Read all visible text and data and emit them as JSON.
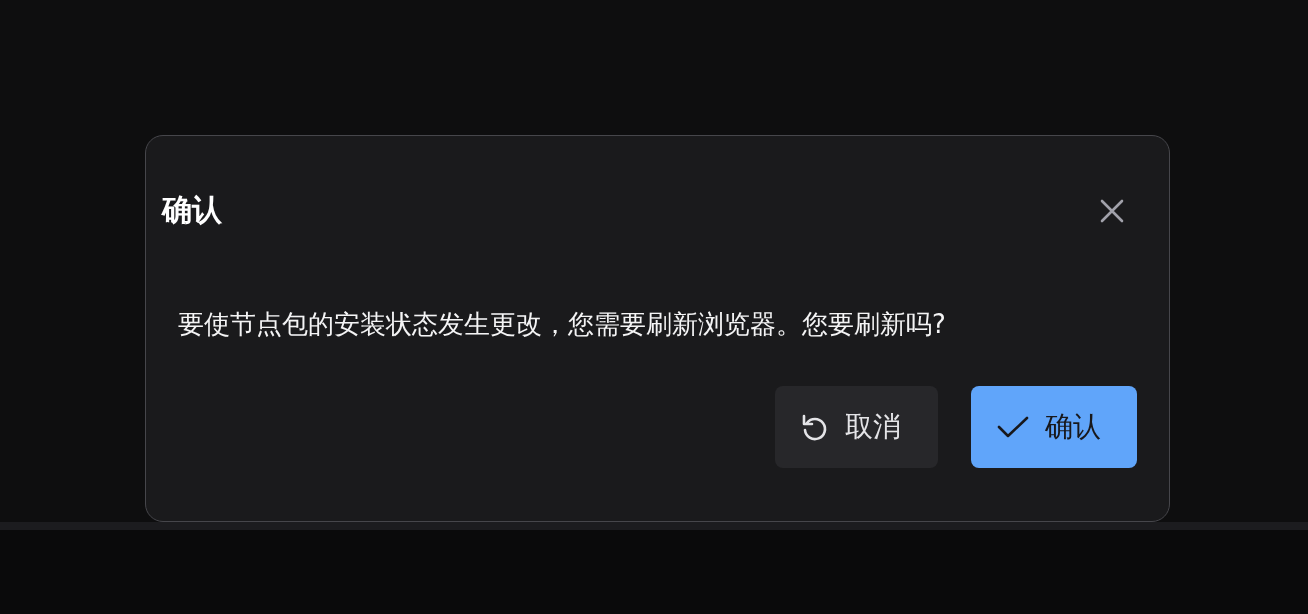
{
  "dialog": {
    "title": "确认",
    "message": "要使节点包的安装状态发生更改，您需要刷新浏览器。您要刷新吗?",
    "buttons": [
      {
        "label": "取消",
        "kind": "cancel"
      },
      {
        "label": "确认",
        "kind": "confirm"
      }
    ]
  }
}
